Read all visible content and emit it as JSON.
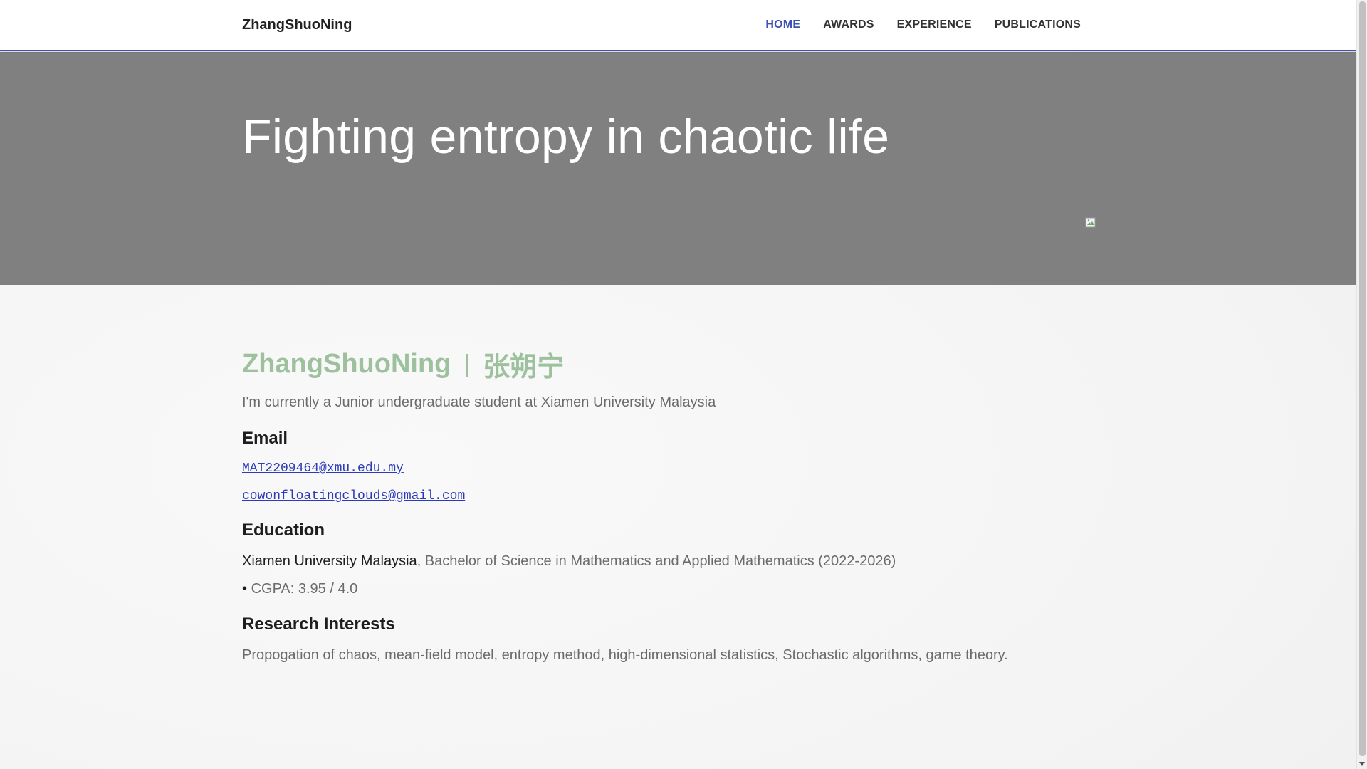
{
  "nav": {
    "brand": "ZhangShuoNing",
    "links": [
      {
        "label": "HOME",
        "active": true
      },
      {
        "label": "AWARDS",
        "active": false
      },
      {
        "label": "EXPERIENCE",
        "active": false
      },
      {
        "label": "PUBLICATIONS",
        "active": false
      }
    ]
  },
  "hero": {
    "title": "Fighting entropy in chaotic life",
    "image_icon": "broken-image-icon"
  },
  "profile": {
    "name_en": "ZhangShuoNing",
    "separator": "|",
    "name_zh": "张朔宁",
    "intro": "I'm currently a Junior undergraduate student at Xiamen University Malaysia"
  },
  "email": {
    "title": "Email",
    "addresses": [
      "MAT2209464@xmu.edu.my",
      "cowonfloatingclouds@gmail.com"
    ]
  },
  "education": {
    "title": "Education",
    "school": "Xiamen University Malaysia",
    "degree": ", Bachelor of Science in Mathematics and Applied Mathematics (2022-2026)",
    "bullet": "•",
    "gpa": " CGPA: 3.95 / 4.0"
  },
  "research": {
    "title": "Research Interests",
    "text": "Propogation of chaos, mean-field model, entropy method, high-dimensional statistics, Stochastic algorithms, game theory."
  },
  "colors": {
    "accent": "#3f51b5",
    "hero_bg": "#808080",
    "name_heading": "#9dc09d",
    "link": "#2b3ab8"
  }
}
